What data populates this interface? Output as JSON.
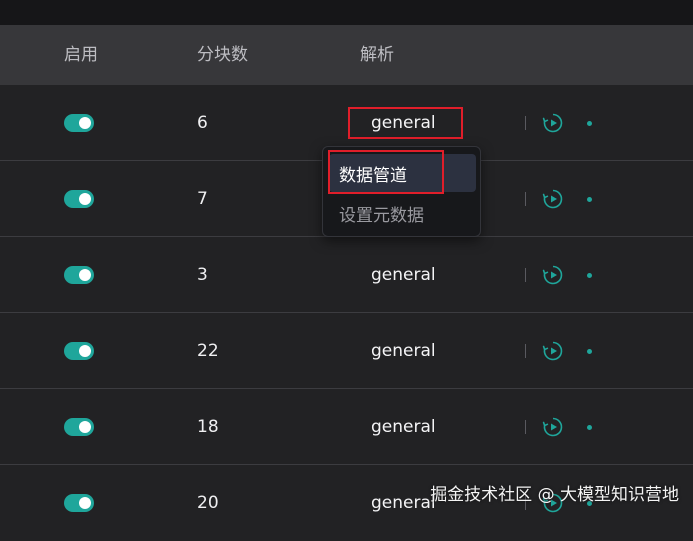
{
  "header": {
    "col_enabled": "启用",
    "col_chunks": "分块数",
    "col_parse": "解析"
  },
  "rows": [
    {
      "enabled": true,
      "chunks": "6",
      "parse": "general"
    },
    {
      "enabled": true,
      "chunks": "7",
      "parse": ""
    },
    {
      "enabled": true,
      "chunks": "3",
      "parse": "general"
    },
    {
      "enabled": true,
      "chunks": "22",
      "parse": "general"
    },
    {
      "enabled": true,
      "chunks": "18",
      "parse": "general"
    },
    {
      "enabled": true,
      "chunks": "20",
      "parse": "general"
    }
  ],
  "dropdown": {
    "items": [
      {
        "label": "数据管道"
      },
      {
        "label": "设置元数据"
      }
    ]
  },
  "watermark": "掘金技术社区 @ 大模型知识营地",
  "colors": {
    "accent": "#1fa69b",
    "highlight": "#e01e2a"
  },
  "icons": {
    "run": "play-refresh-icon",
    "more": "dot-icon"
  }
}
